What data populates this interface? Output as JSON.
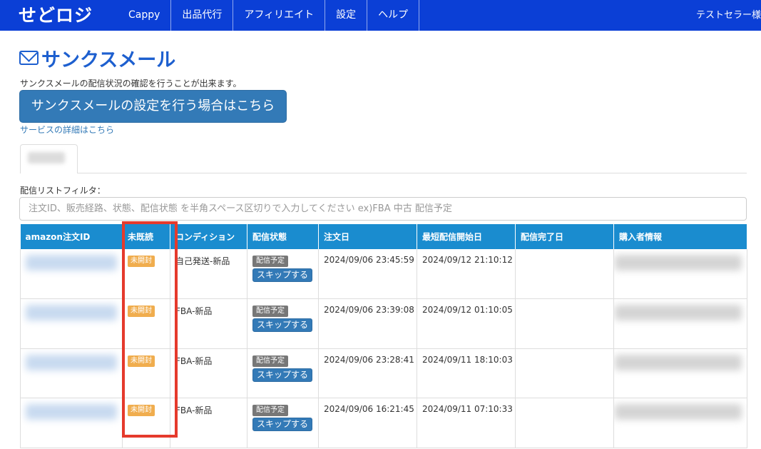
{
  "header": {
    "brand": "せどロジ",
    "nav": [
      "Cappy",
      "出品代行",
      "アフィリエイト",
      "設定",
      "ヘルプ"
    ],
    "user": "テストセラー様"
  },
  "page": {
    "title": "サンクスメール",
    "description": "サンクスメールの配信状況の確認を行うことが出来ます。",
    "settings_button": "サンクスメールの設定を行う場合はこちら",
    "detail_link": "サービスの詳細はこちら"
  },
  "filter": {
    "label": "配信リストフィルタ：",
    "placeholder": "注文ID、販売経路、状態、配信状態 を半角スペース区切りで入力してください ex)FBA 中古 配信予定"
  },
  "table": {
    "columns": [
      "amazon注文ID",
      "未既読",
      "コンディション",
      "配信状態",
      "注文日",
      "最短配信開始日",
      "配信完了日",
      "購入者情報"
    ],
    "rows": [
      {
        "read": "未開封",
        "condition": "自己発送-新品",
        "status": "配信予定",
        "skip": "スキップする",
        "order_date": "2024/09/06 23:45:59",
        "earliest_start": "2024/09/12 21:10:12",
        "completed": ""
      },
      {
        "read": "未開封",
        "condition": "FBA-新品",
        "status": "配信予定",
        "skip": "スキップする",
        "order_date": "2024/09/06 23:39:08",
        "earliest_start": "2024/09/12 01:10:05",
        "completed": ""
      },
      {
        "read": "未開封",
        "condition": "FBA-新品",
        "status": "配信予定",
        "skip": "スキップする",
        "order_date": "2024/09/06 23:28:41",
        "earliest_start": "2024/09/11 18:10:03",
        "completed": ""
      },
      {
        "read": "未開封",
        "condition": "FBA-新品",
        "status": "配信予定",
        "skip": "スキップする",
        "order_date": "2024/09/06 16:21:45",
        "earliest_start": "2024/09/11 07:10:33",
        "completed": ""
      }
    ]
  },
  "colors": {
    "navbar": "#0b3fd6",
    "title": "#1d5fcf",
    "table_header": "#1a8ccf",
    "primary_button": "#337ab7",
    "unread_badge": "#f0ad4e",
    "status_badge": "#777777",
    "highlight": "#e53a2c"
  }
}
